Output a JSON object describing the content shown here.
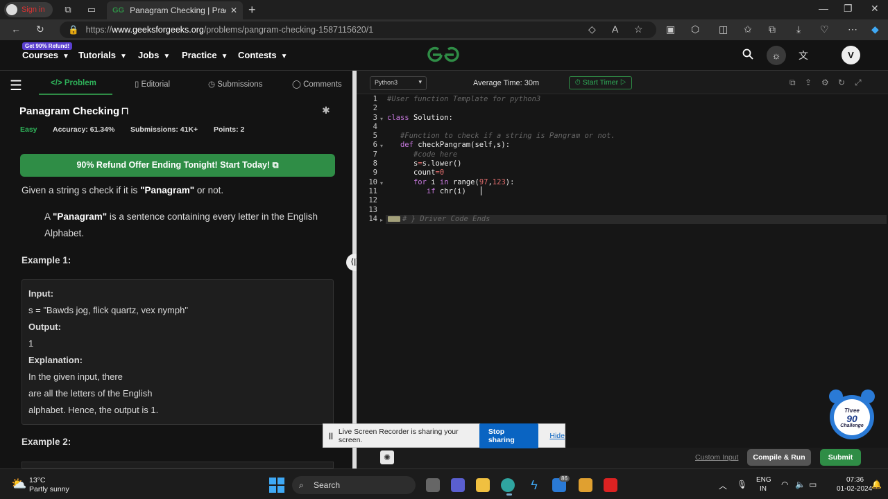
{
  "browser": {
    "signin_label": "Sign in",
    "tab_title": "Panagram Checking | Practice | G",
    "url_prefix": "https://",
    "url_domain": "www.geeksforgeeks.org",
    "url_path": "/problems/pangram-checking-1587115620/1"
  },
  "site": {
    "promo_badge": "Get 90% Refund!",
    "nav": [
      "Courses",
      "Tutorials",
      "Jobs",
      "Practice",
      "Contests"
    ],
    "avatar_initial": "V",
    "brand_color": "#2f8d46"
  },
  "problem": {
    "tabs": [
      "Problem",
      "Editorial",
      "Submissions",
      "Comments"
    ],
    "title": "Panagram Checking",
    "difficulty": "Easy",
    "accuracy": "Accuracy: 61.34%",
    "submissions": "Submissions: 41K+",
    "points": "Points: 2",
    "offer_text": "90% Refund Offer Ending Tonight! Start Today!",
    "desc_pre": "Given a string s check if it is ",
    "desc_bold": "\"Panagram\"",
    "desc_post": " or not.",
    "def_pre": "A ",
    "def_bold": "\"Panagram\"",
    "def_post": " is a sentence containing every letter in the English Alphabet.",
    "example1_heading": "Example 1:",
    "example1": {
      "input_label": "Input:",
      "input_value": "s = \"Bawds jog, flick quartz, vex nymph\"",
      "output_label": "Output:",
      "output_value": "1",
      "explanation_label": "Explanation:",
      "explanation_lines": [
        "In the given input, there",
        "are all the letters of the English",
        "alphabet. Hence, the output is 1."
      ]
    },
    "example2_heading": "Example 2:"
  },
  "editor": {
    "language": "Python3",
    "average_time": "Average Time: 30m",
    "start_timer": "Start Timer",
    "line_numbers": [
      "1",
      "2",
      "3",
      "4",
      "5",
      "6",
      "7",
      "8",
      "9",
      "10",
      "11",
      "12",
      "13",
      "14"
    ],
    "custom_input": "Custom Input",
    "compile_run": "Compile & Run",
    "submit": "Submit"
  },
  "share_banner": {
    "message": "Live Screen Recorder is sharing your screen.",
    "stop": "Stop sharing",
    "hide": "Hide"
  },
  "challenge": {
    "line1": "Three",
    "line2": "90",
    "line3": "Challenge"
  },
  "taskbar": {
    "temperature": "13°C",
    "weather": "Partly sunny",
    "search": "Search",
    "notif_count": "86",
    "lang_top": "ENG",
    "lang_bottom": "IN",
    "time": "07:36",
    "date": "01-02-2024"
  }
}
